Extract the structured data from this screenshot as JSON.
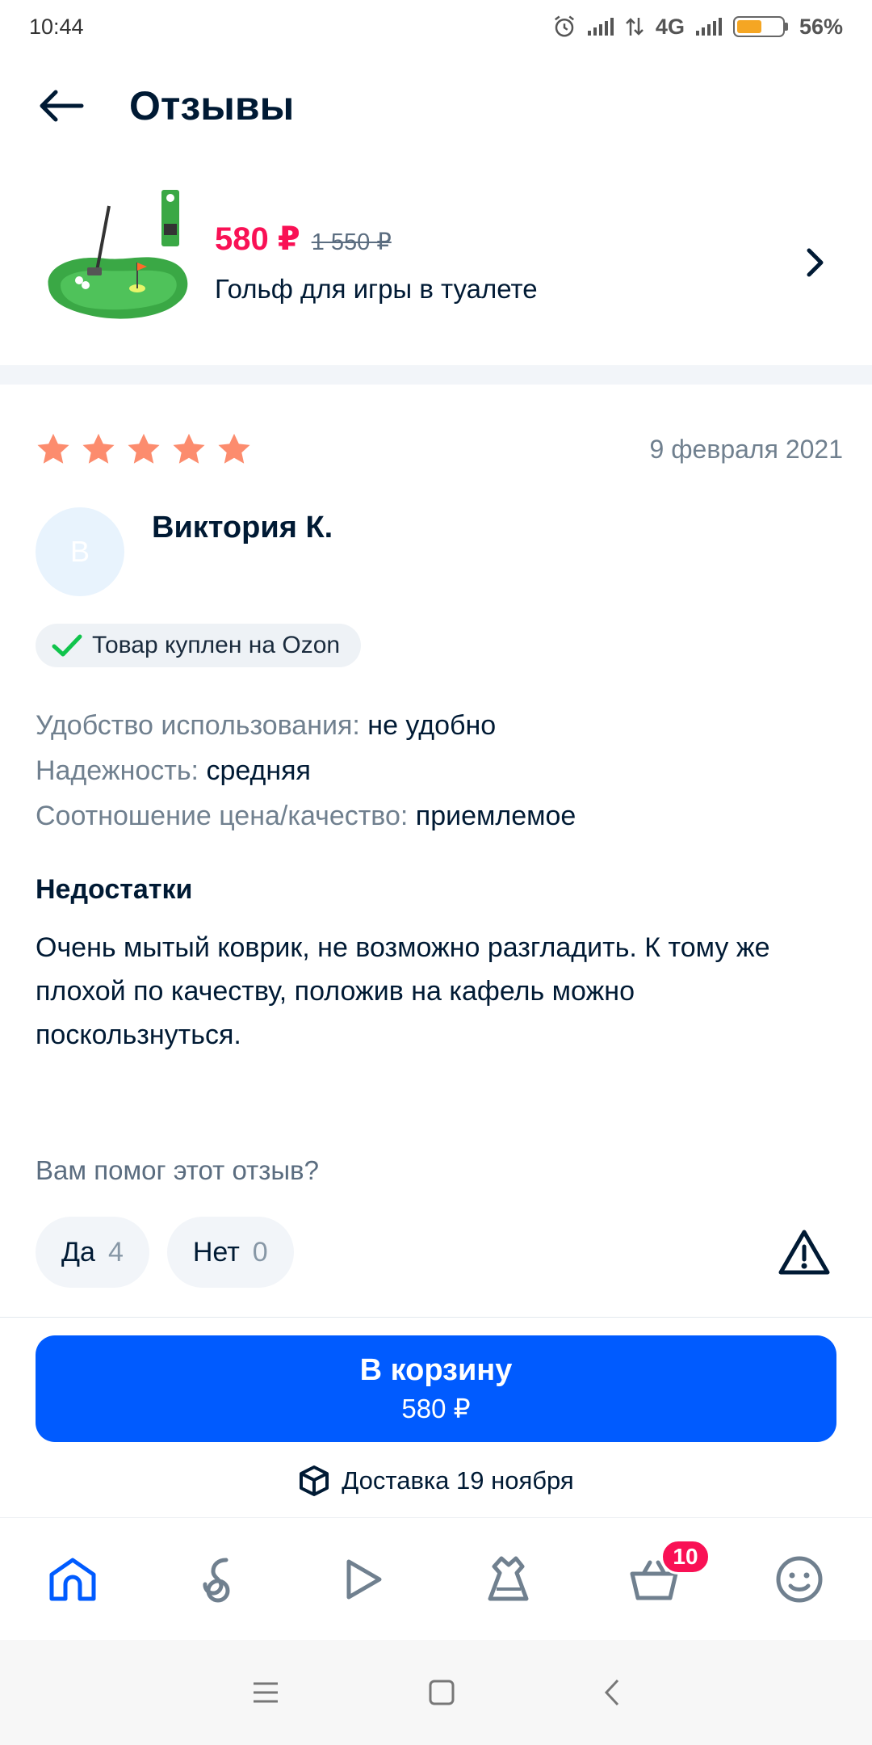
{
  "status_bar": {
    "time": "10:44",
    "network": "4G",
    "battery": "56%",
    "battery_level": 0.56
  },
  "header": {
    "title": "Отзывы",
    "back_icon": "arrow-left-icon"
  },
  "product": {
    "price": "580 ₽",
    "old_price": "1 550 ₽",
    "name": "Гольф для игры в туалете",
    "chevron_icon": "chevron-right-icon"
  },
  "review": {
    "rating": 5,
    "rating_max": 5,
    "star_color": "#fc8c6e",
    "date": "9 февраля 2021",
    "author": {
      "initial": "В",
      "name": "Виктория К."
    },
    "verified_label": "Товар куплен на Ozon",
    "attributes": [
      {
        "label": "Удобство использования:",
        "value": "не удобно"
      },
      {
        "label": "Надежность:",
        "value": "средняя"
      },
      {
        "label": "Соотношение цена/качество:",
        "value": "приемлемое"
      }
    ],
    "cons_title": "Недостатки",
    "cons_text": "Очень мытый коврик, не возможно разгладить. К тому же плохой по качеству, положив на кафель можно поскользнуться.",
    "helpful_question": "Вам помог этот отзыв?",
    "votes": {
      "yes_label": "Да",
      "yes_count": "4",
      "no_label": "Нет",
      "no_count": "0"
    }
  },
  "cart": {
    "button_label": "В корзину",
    "button_price": "580 ₽",
    "delivery": "Доставка 19 ноября",
    "accent": "#005bff"
  },
  "tab_bar": {
    "tabs": [
      "home-icon",
      "fresh-icon",
      "video-icon",
      "fashion-icon",
      "cart-icon",
      "profile-icon"
    ],
    "cart_badge": "10"
  }
}
